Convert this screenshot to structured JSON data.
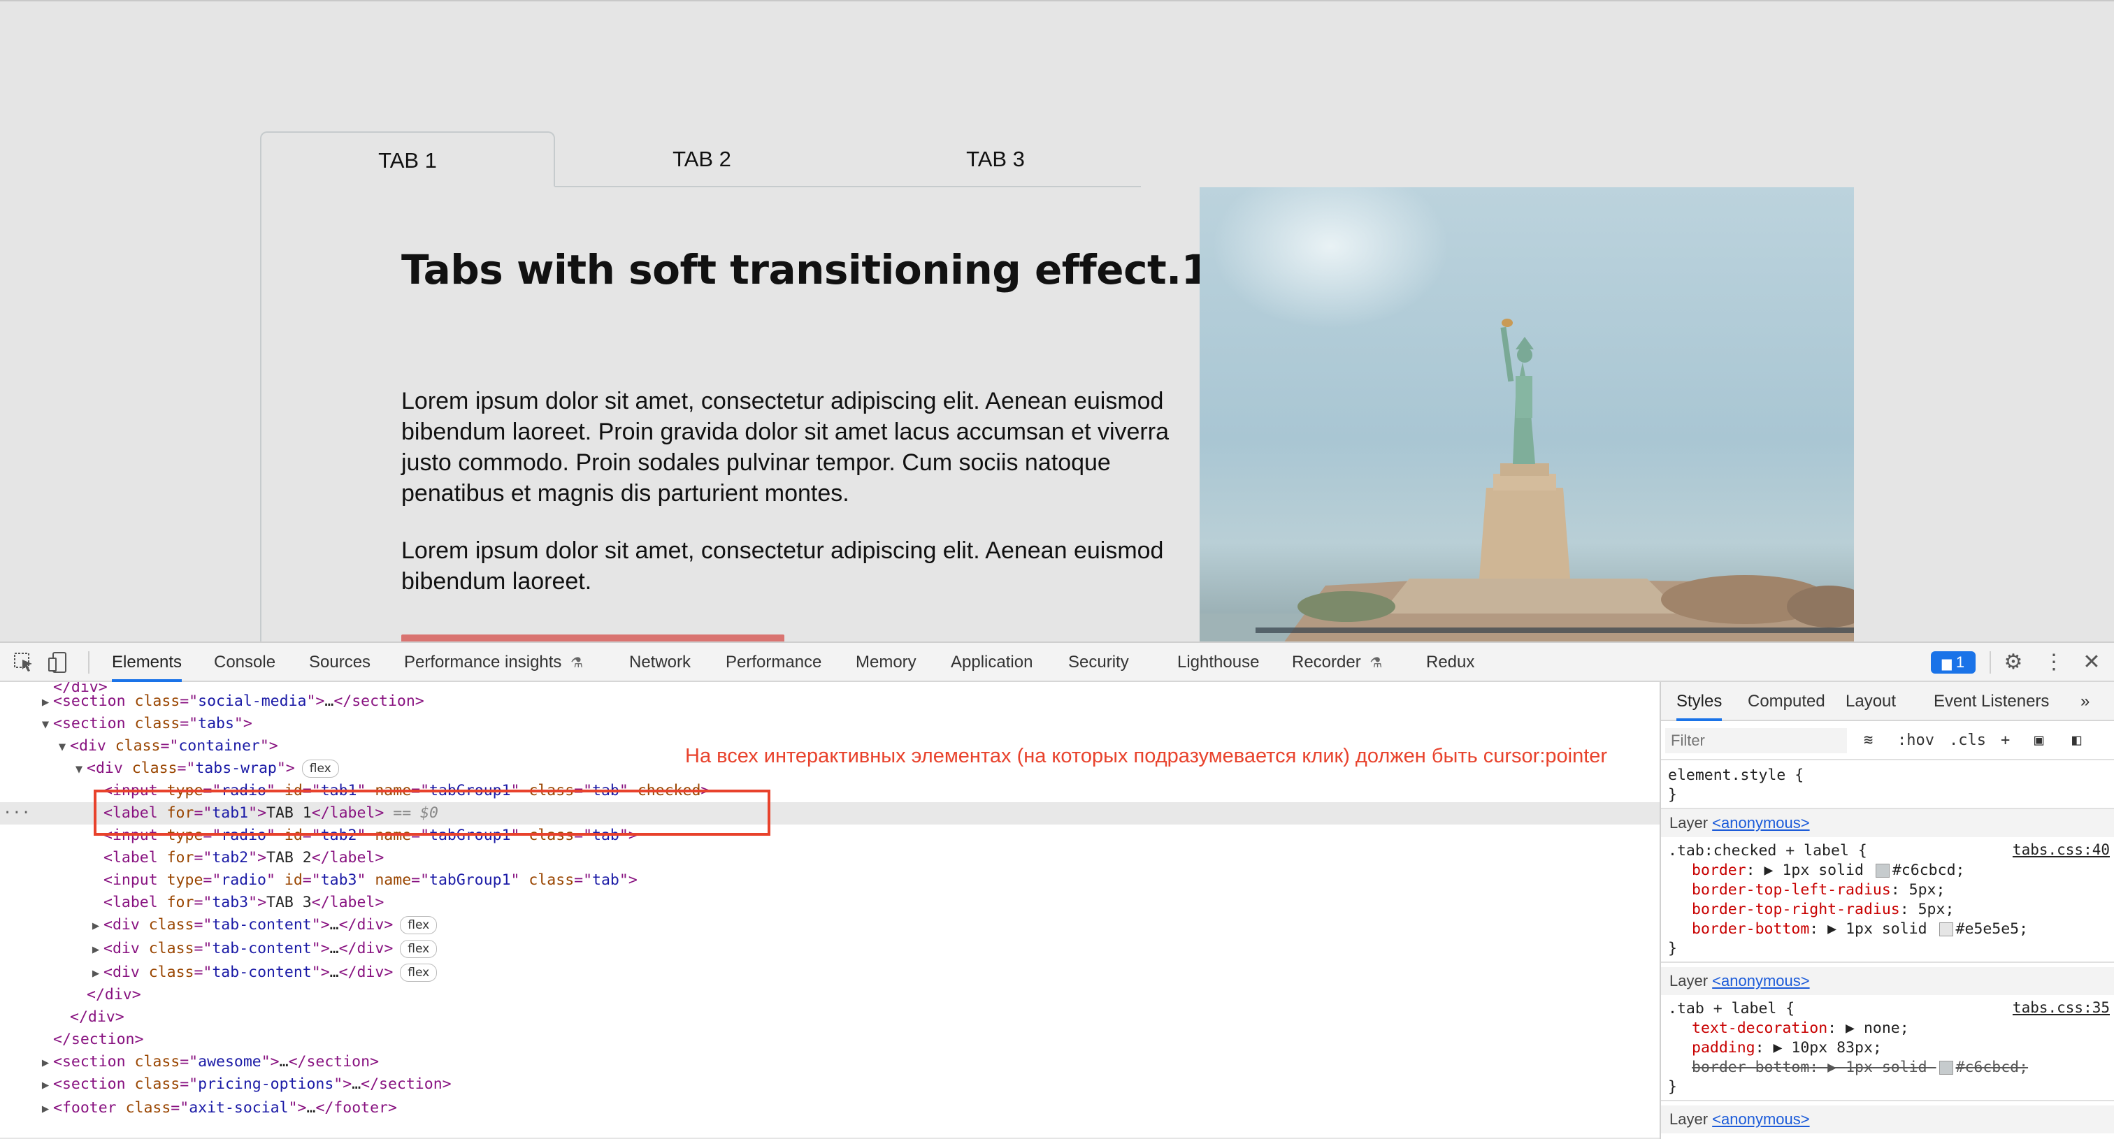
{
  "page": {
    "tabs": [
      {
        "label": "TAB 1",
        "active": true
      },
      {
        "label": "TAB 2",
        "active": false
      },
      {
        "label": "TAB 3",
        "active": false
      }
    ],
    "content": {
      "title": "Tabs with soft transitioning effect.1",
      "paragraph1": "Lorem ipsum dolor sit amet, consectetur adipiscing elit. Aenean euismod bibendum laoreet. Proin gravida dolor sit amet lacus accumsan et viverra justo commodo. Proin sodales pulvinar tempor. Cum sociis natoque penatibus et magnis dis parturient montes.",
      "paragraph2": "Lorem ipsum dolor sit amet, consectetur adipiscing elit. Aenean euismod bibendum laoreet."
    },
    "image_subject": "statue-of-liberty"
  },
  "devtools": {
    "tabs": [
      "Elements",
      "Console",
      "Sources",
      "Performance insights",
      "Network",
      "Performance",
      "Memory",
      "Application",
      "Security",
      "Lighthouse",
      "Recorder",
      "Redux"
    ],
    "active_tab": "Elements",
    "issues_count": "1",
    "annotation": "На всех интерактивных элементах (на которых подразумевается клик) должен быть cursor:pointer",
    "dom": {
      "partial_top": "</div>",
      "social_media": {
        "tag": "section",
        "class": "social-media",
        "ellipsis": "…",
        "close": "</section>"
      },
      "tabs_section": {
        "tag": "section",
        "class": "tabs"
      },
      "container": {
        "tag": "div",
        "class": "container"
      },
      "tabs_wrap": {
        "tag": "div",
        "class": "tabs-wrap",
        "badge": "flex"
      },
      "input1": {
        "type": "radio",
        "id": "tab1",
        "name": "tabGroup1",
        "class": "tab",
        "checked": "checked"
      },
      "label1": {
        "for": "tab1",
        "text": "TAB 1",
        "marker": "== $0"
      },
      "input2": {
        "type": "radio",
        "id": "tab2",
        "name": "tabGroup1",
        "class": "tab"
      },
      "label2": {
        "for": "tab2",
        "text": "TAB 2"
      },
      "input3": {
        "type": "radio",
        "id": "tab3",
        "name": "tabGroup1",
        "class": "tab"
      },
      "label3": {
        "for": "tab3",
        "text": "TAB 3"
      },
      "tab_content": {
        "class": "tab-content",
        "badge": "flex"
      },
      "close_div": "</div>",
      "close_section": "</section>",
      "awesome": {
        "class": "awesome"
      },
      "pricing": {
        "class": "pricing-options"
      },
      "footer": {
        "class": "axit-social"
      }
    },
    "styles": {
      "tabs": [
        "Styles",
        "Computed",
        "Layout",
        "Event Listeners"
      ],
      "active_tab": "Styles",
      "filter_placeholder": "Filter",
      "hov": ":hov",
      "cls": ".cls",
      "element_style": "element.style {",
      "close_brace": "}",
      "layer_label": "Layer",
      "layer_link": "<anonymous>",
      "rule1": {
        "selector": ".tab:checked + label {",
        "file": "tabs.css:40",
        "decls": [
          {
            "prop": "border",
            "value": "1px solid",
            "color": "#c6cbcd",
            "suffix": "#c6cbcd;",
            "expand": true
          },
          {
            "prop": "border-top-left-radius",
            "value": "5px;"
          },
          {
            "prop": "border-top-right-radius",
            "value": "5px;"
          },
          {
            "prop": "border-bottom",
            "value": "1px solid",
            "color": "#e5e5e5",
            "suffix": "#e5e5e5;",
            "expand": true
          }
        ]
      },
      "rule2": {
        "selector": ".tab + label {",
        "file": "tabs.css:35",
        "decls": [
          {
            "prop": "text-decoration",
            "value": "none;",
            "expand": true
          },
          {
            "prop": "padding",
            "value": "10px 83px;",
            "expand": true
          },
          {
            "prop": "border-bottom",
            "value": "1px solid",
            "color": "#c6cbcd",
            "suffix": "#c6cbcd;",
            "expand": true,
            "struck": true
          }
        ]
      }
    }
  }
}
